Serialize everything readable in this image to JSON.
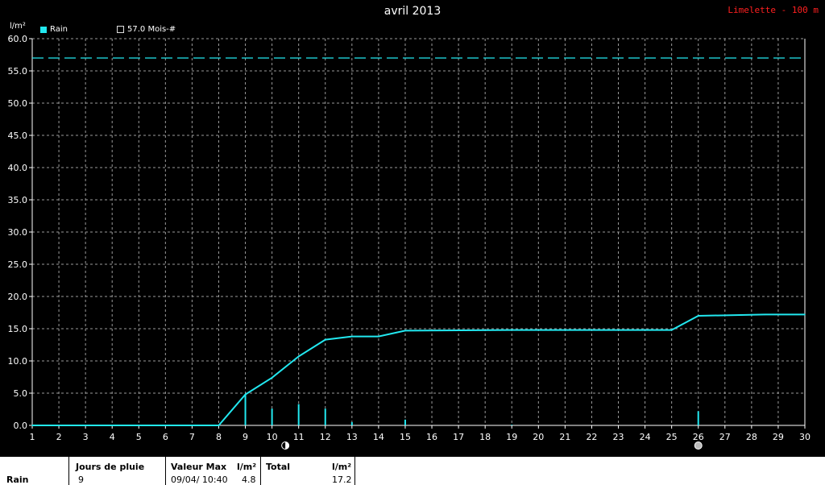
{
  "title": "avril 2013",
  "station": "Limelette - 100 m",
  "unit_label": "l/m²",
  "legend": {
    "rain": "Rain",
    "reference": "57.0 Mois-#"
  },
  "colors": {
    "series": "#22e8f0",
    "grid": "#9a9a9a",
    "station": "#ff2020"
  },
  "x_ticks": [
    "1",
    "2",
    "3",
    "4",
    "5",
    "6",
    "7",
    "8",
    "9",
    "10",
    "11",
    "12",
    "13",
    "14",
    "15",
    "16",
    "17",
    "18",
    "19",
    "20",
    "21",
    "22",
    "23",
    "24",
    "25",
    "26",
    "27",
    "28",
    "29",
    "30"
  ],
  "y_ticks": [
    "0.0",
    "5.0",
    "10.0",
    "15.0",
    "20.0",
    "25.0",
    "30.0",
    "35.0",
    "40.0",
    "45.0",
    "50.0",
    "55.0",
    "60.0"
  ],
  "moon_icons": [
    {
      "day": 10.5,
      "name": "first-quarter-moon-icon"
    },
    {
      "day": 26,
      "name": "full-moon-icon"
    }
  ],
  "chart_data": {
    "type": "line",
    "title": "avril 2013",
    "ylabel": "l/m²",
    "xlim": [
      1,
      30
    ],
    "ylim": [
      0,
      60
    ],
    "grid": true,
    "legend_position": "top-left",
    "series": [
      {
        "name": "Rain",
        "kind": "cumulative",
        "x": [
          1,
          8,
          9,
          10,
          11,
          12,
          13,
          14,
          15,
          19,
          25,
          26,
          28.5,
          30
        ],
        "values": [
          0.0,
          0.0,
          4.8,
          7.4,
          10.7,
          13.3,
          13.8,
          13.8,
          14.7,
          14.8,
          14.8,
          17.0,
          17.2,
          17.2
        ]
      },
      {
        "name": "Rain",
        "kind": "daily",
        "x": [
          9,
          10,
          11,
          12,
          13,
          15,
          19,
          26
        ],
        "values": [
          4.8,
          2.6,
          3.3,
          2.6,
          0.5,
          0.9,
          0.1,
          2.2
        ]
      },
      {
        "name": "57.0 Mois-#",
        "kind": "reference",
        "x": [
          1,
          30
        ],
        "values": [
          57.0,
          57.0
        ]
      }
    ]
  },
  "summary": {
    "row_label": "Rain",
    "jours_header": "Jours de pluie",
    "jours_value": "9",
    "max_header": "Valeur Max",
    "max_unit_header": "l/m²",
    "max_date": "09/04/ 10:40",
    "max_value": "4.8",
    "total_header": "Total",
    "total_unit_header": "l/m²",
    "total_value": "17.2"
  }
}
